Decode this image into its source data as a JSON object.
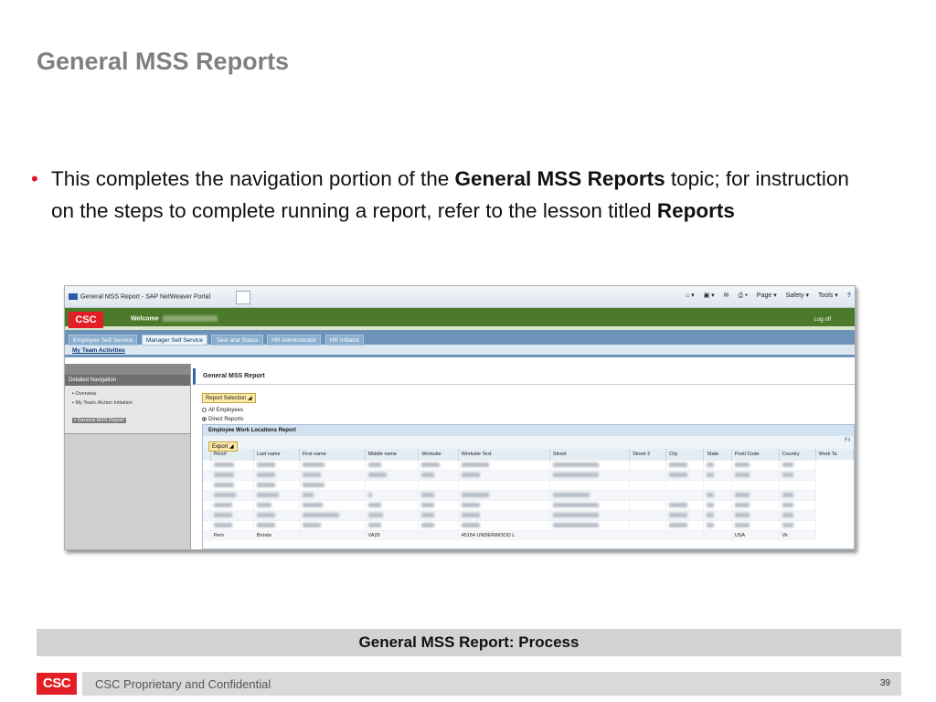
{
  "slide": {
    "title": "General MSS Reports",
    "bullet_part1": "This completes the navigation portion of the ",
    "bullet_bold1": "General MSS Reports",
    "bullet_part2": " topic; for instruction on the steps to complete running a report, refer to the lesson titled ",
    "bullet_bold2": "Reports",
    "caption": "General MSS Report: Process",
    "footer": "CSC Proprietary and Confidential",
    "page_number": "39",
    "logo_text": "CSC"
  },
  "browser": {
    "tab_title": "General MSS Report - SAP NetWeaver Portal",
    "tools": [
      "Page ▾",
      "Safety ▾",
      "Tools ▾"
    ]
  },
  "portal": {
    "logo_text": "CSC",
    "welcome": "Welcome",
    "logoff": "Log off",
    "tabs": [
      "Employee Self Service",
      "Manager Self Service",
      "Task and Status",
      "HR Administrator",
      "HR Initiator"
    ],
    "active_tab": "Manager Self Service",
    "subnav": "My Team Activities"
  },
  "detailed_nav": {
    "title": "Detailed Navigation",
    "items": [
      "Overview",
      "My Team /Action Initiation",
      "General MSS Report"
    ],
    "selected": "General MSS Report"
  },
  "report": {
    "title": "General MSS Report",
    "selection_button": "Report Selection",
    "radio_all": "All Employees",
    "radio_direct": "Direct Reports",
    "table_title": "Employee Work Locations Report",
    "export_button": "Export",
    "filter_link": "Fil",
    "columns": [
      "Pers#",
      "Last name",
      "First name",
      "Middle name",
      "Worksite",
      "Worksite Text",
      "Street",
      "Street 2",
      "City",
      "State",
      "Postl Code",
      "Country",
      "Work Ta"
    ],
    "last_row": [
      "",
      "Pern",
      "Brinda",
      "",
      "VA25",
      "",
      "45154 UNDERWOOD L",
      "",
      "",
      "",
      "",
      "USA",
      "Vir"
    ]
  }
}
